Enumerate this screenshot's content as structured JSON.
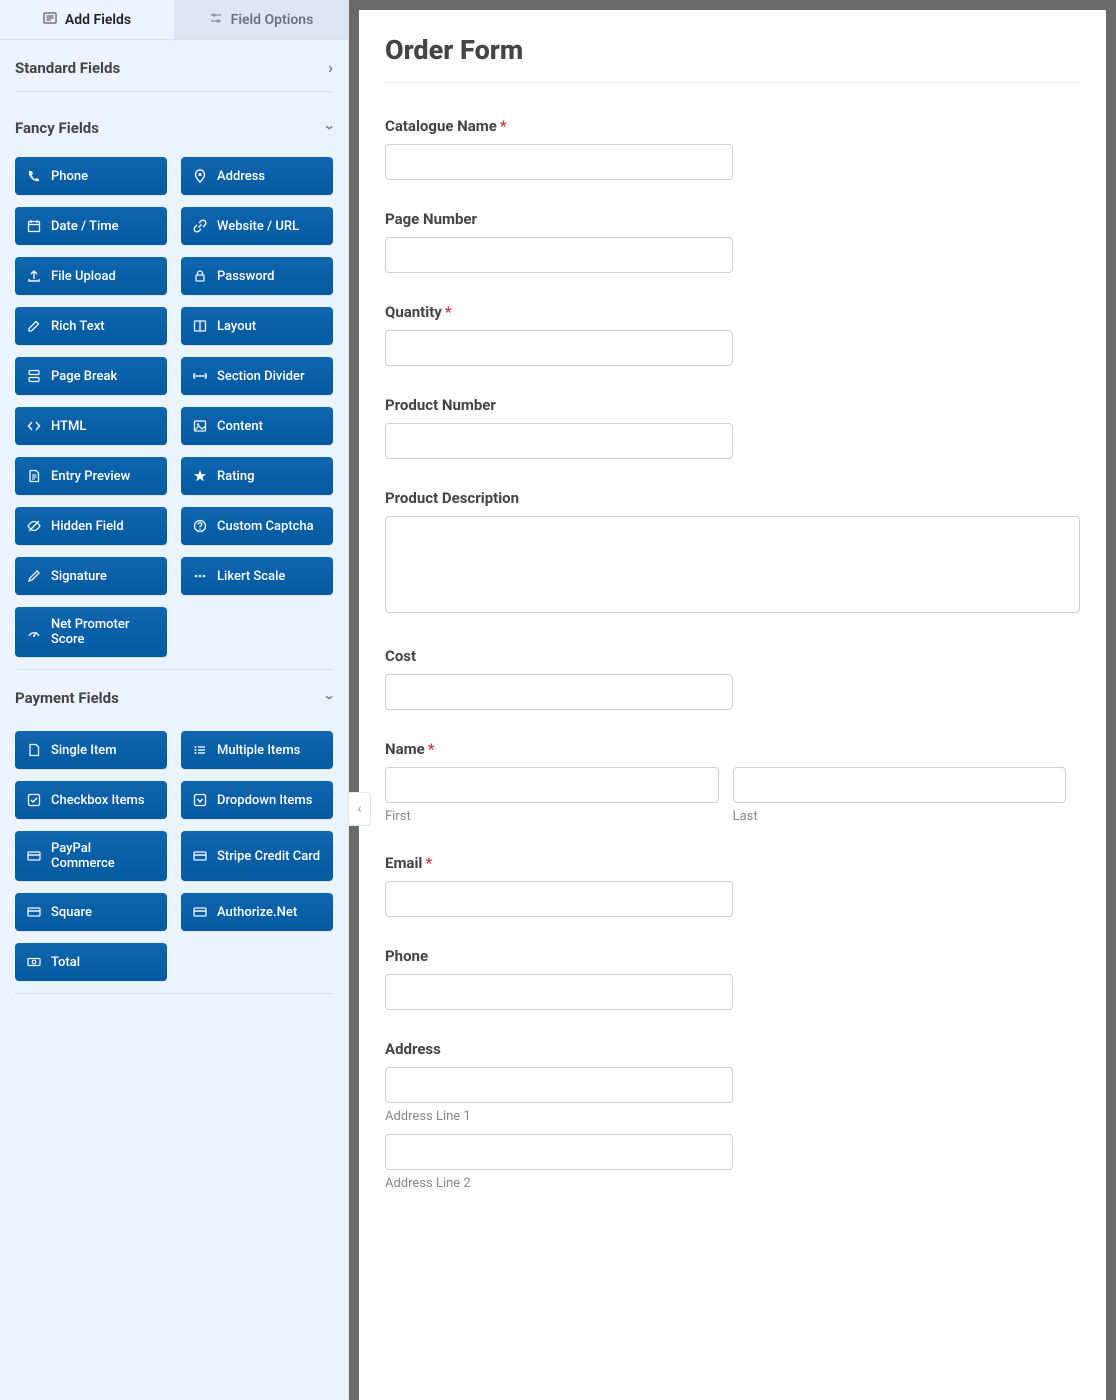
{
  "tabs": {
    "add": "Add Fields",
    "options": "Field Options"
  },
  "sections": {
    "standard": {
      "title": "Standard Fields"
    },
    "fancy": {
      "title": "Fancy Fields"
    },
    "payment": {
      "title": "Payment Fields"
    }
  },
  "fancy_fields": [
    {
      "icon": "phone",
      "label": "Phone"
    },
    {
      "icon": "map-pin",
      "label": "Address"
    },
    {
      "icon": "calendar",
      "label": "Date / Time"
    },
    {
      "icon": "link",
      "label": "Website / URL"
    },
    {
      "icon": "upload",
      "label": "File Upload"
    },
    {
      "icon": "lock",
      "label": "Password"
    },
    {
      "icon": "edit",
      "label": "Rich Text"
    },
    {
      "icon": "columns",
      "label": "Layout"
    },
    {
      "icon": "page-break",
      "label": "Page Break"
    },
    {
      "icon": "divider",
      "label": "Section Divider"
    },
    {
      "icon": "code",
      "label": "HTML"
    },
    {
      "icon": "image",
      "label": "Content"
    },
    {
      "icon": "file-text",
      "label": "Entry Preview"
    },
    {
      "icon": "star",
      "label": "Rating"
    },
    {
      "icon": "eye-off",
      "label": "Hidden Field"
    },
    {
      "icon": "help",
      "label": "Custom Captcha"
    },
    {
      "icon": "pen",
      "label": "Signature"
    },
    {
      "icon": "dots",
      "label": "Likert Scale"
    },
    {
      "icon": "gauge",
      "label": "Net Promoter Score"
    }
  ],
  "payment_fields": [
    {
      "icon": "file",
      "label": "Single Item"
    },
    {
      "icon": "list",
      "label": "Multiple Items"
    },
    {
      "icon": "check-square",
      "label": "Checkbox Items"
    },
    {
      "icon": "caret-square",
      "label": "Dropdown Items"
    },
    {
      "icon": "card",
      "label": "PayPal Commerce"
    },
    {
      "icon": "card",
      "label": "Stripe Credit Card"
    },
    {
      "icon": "card",
      "label": "Square"
    },
    {
      "icon": "card",
      "label": "Authorize.Net"
    },
    {
      "icon": "cash",
      "label": "Total"
    }
  ],
  "form": {
    "title": "Order Form",
    "fields": {
      "catalogue": {
        "label": "Catalogue Name",
        "required": true
      },
      "page_no": {
        "label": "Page Number",
        "required": false
      },
      "quantity": {
        "label": "Quantity",
        "required": true
      },
      "product_no": {
        "label": "Product Number",
        "required": false
      },
      "prod_desc": {
        "label": "Product Description",
        "required": false
      },
      "cost": {
        "label": "Cost",
        "required": false
      },
      "name": {
        "label": "Name",
        "required": true,
        "first": "First",
        "last": "Last"
      },
      "email": {
        "label": "Email",
        "required": true
      },
      "phone": {
        "label": "Phone",
        "required": false
      },
      "address": {
        "label": "Address",
        "line1": "Address Line 1",
        "line2": "Address Line 2"
      }
    }
  },
  "req_mark": "*"
}
